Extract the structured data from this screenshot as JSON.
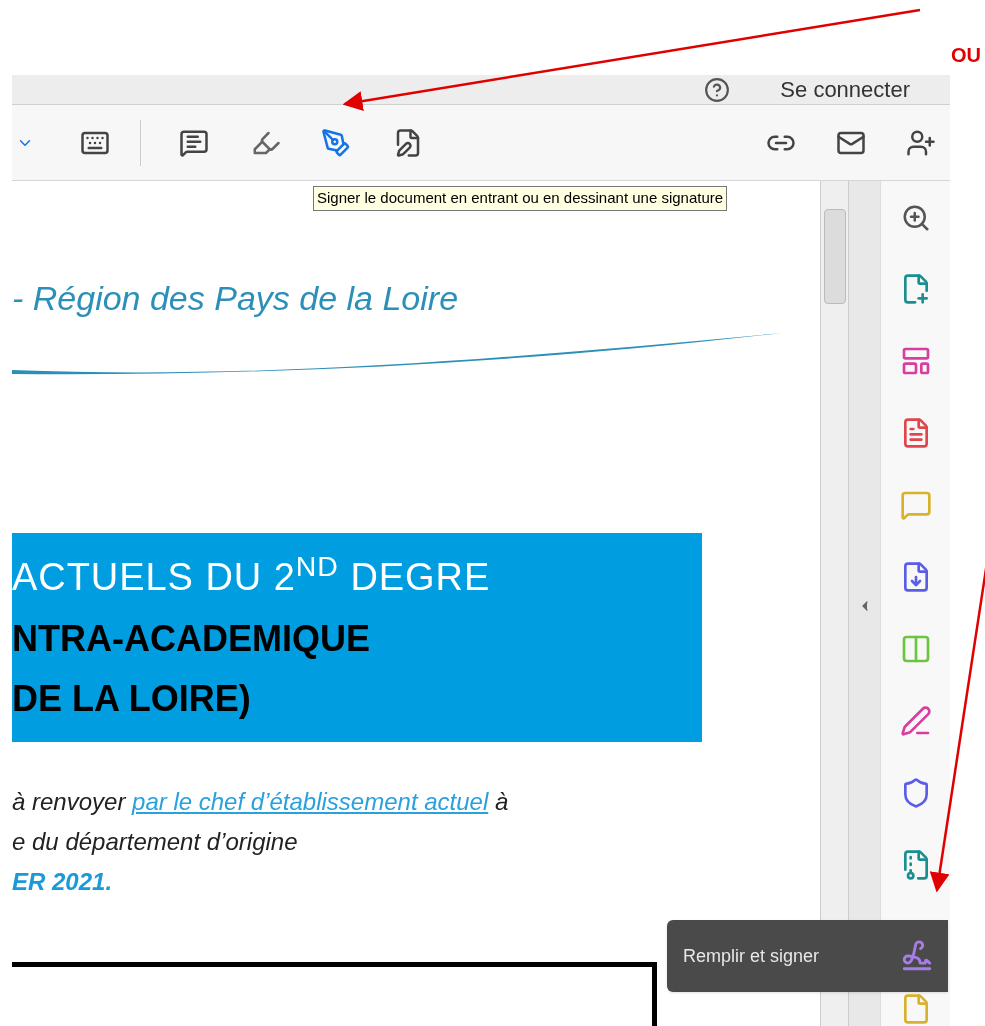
{
  "annotation": {
    "label": "OU"
  },
  "top_bar": {
    "sign_in": "Se connecter"
  },
  "toolbar": {
    "tooltip": "Signer le document en entrant ou en dessinant une signature"
  },
  "document": {
    "header": "- Région des Pays de la Loire",
    "banner_lines": [
      "ACTUELS DU 2$^{ND}$ DEGRE",
      "NTRA-ACADEMIQUE",
      "DE LA LOIRE)"
    ],
    "paragraph": {
      "before": "à renvoyer ",
      "link": "par le chef d’établissement actuel",
      "after": " à",
      "line_2": "e du département d’origine",
      "line_3": "ER 2021."
    }
  },
  "tool_pane": {
    "tooltip": "Remplir et signer"
  }
}
